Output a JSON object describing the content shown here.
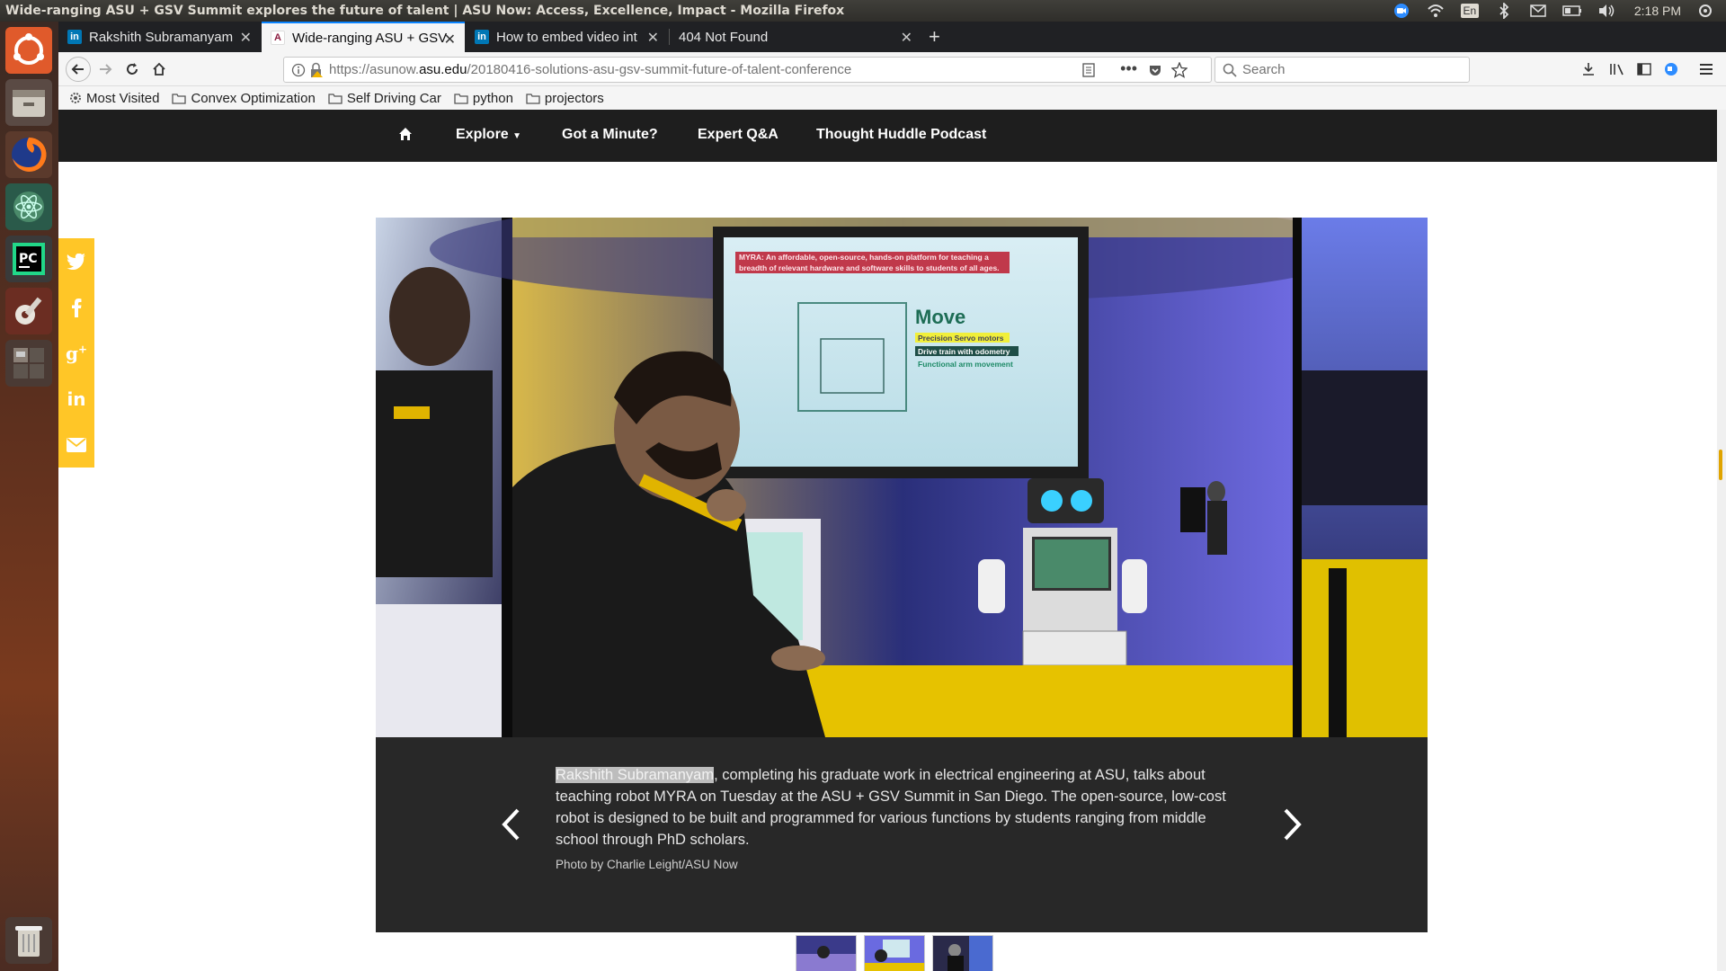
{
  "system_bar": {
    "window_title": "Wide-ranging ASU + GSV Summit explores the future of talent | ASU Now: Access, Excellence, Impact - Mozilla Firefox",
    "keyboard_layout": "En",
    "clock": "2:18 PM"
  },
  "browser": {
    "tabs": [
      {
        "label": "Rakshith Subramanyam",
        "favicon": "linkedin-icon",
        "active": false
      },
      {
        "label": "Wide-ranging ASU + GSV",
        "favicon": "asu-icon",
        "active": true
      },
      {
        "label": "How to embed video int",
        "favicon": "linkedin-icon",
        "active": false
      },
      {
        "label": "404 Not Found",
        "favicon": "",
        "active": false
      }
    ],
    "url_prefix": "https://asunow.",
    "url_domain": "asu.edu",
    "url_path": "/20180416-solutions-asu-gsv-summit-future-of-talent-conference",
    "search_placeholder": "Search",
    "bookmarks": [
      {
        "label": "Most Visited",
        "icon": "gear-icon"
      },
      {
        "label": "Convex Optimization",
        "icon": "folder-icon"
      },
      {
        "label": "Self Driving Car",
        "icon": "folder-icon"
      },
      {
        "label": "python",
        "icon": "folder-icon"
      },
      {
        "label": "projectors",
        "icon": "folder-icon"
      }
    ]
  },
  "site": {
    "nav": {
      "explore": "Explore",
      "got_a_minute": "Got a Minute?",
      "expert_qa": "Expert Q&A",
      "podcast": "Thought Huddle Podcast"
    },
    "slide": {
      "caption_name": "Rakshith Subramanyam",
      "caption_rest": ", completing his graduate work in electrical engineering at ASU, talks about teaching robot MYRA on Tuesday at the ASU + GSV Summit in San Diego. The open-source, low-cost robot is designed to be built and programmed for various functions by students ranging from middle school through PhD scholars.",
      "credit": "Photo by Charlie Leight/ASU Now",
      "screen_text": {
        "banner_line1": "MYRA: An affordable, open-source, hands-on platform for teaching a",
        "banner_line2": "breadth of relevant hardware and software skills to students of all ages.",
        "heading": "Move",
        "item1": "Precision Servo motors",
        "item2": "Drive train with odometry",
        "item3": "Functional arm movement"
      }
    }
  },
  "colors": {
    "asu_gold": "#ffc627",
    "nav_bg": "#1e1e1e",
    "caption_bg": "#282828",
    "firefox_blue": "#0a84ff"
  }
}
